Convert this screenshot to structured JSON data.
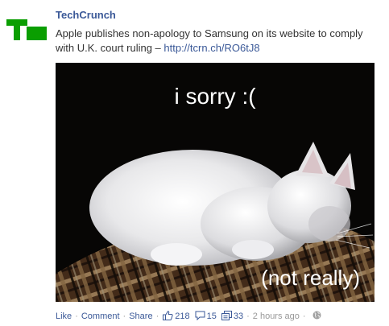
{
  "post": {
    "author": "TechCrunch",
    "message_text": "Apple publishes non-apology to Samsung on its website to comply with U.K. court ruling – ",
    "link_text": "http://tcrn.ch/RO6tJ8"
  },
  "image": {
    "caption_top": "i sorry :(",
    "caption_bottom": "(not really)"
  },
  "actions": {
    "like": "Like",
    "comment": "Comment",
    "share": "Share",
    "separator": "·",
    "likes_count": "218",
    "comments_count": "15",
    "shares_count": "33",
    "timestamp": "2 hours ago"
  },
  "colors": {
    "brand_green": "#0a9e01",
    "link_blue": "#3b5998",
    "meta_gray": "#999999"
  },
  "icons": {
    "logo": "techcrunch-logo",
    "likes": "thumbs-up-icon",
    "comments": "comment-bubble-icon",
    "shares": "share-icon",
    "privacy": "globe-icon"
  }
}
